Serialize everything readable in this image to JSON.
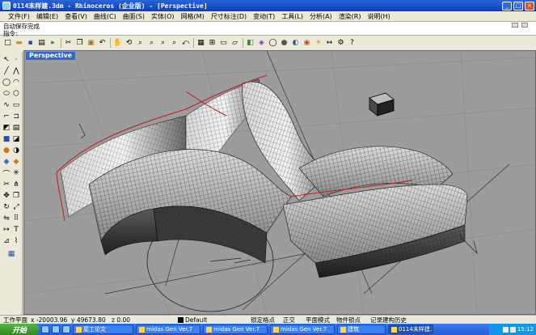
{
  "window": {
    "title": "0114末样建.3dm - Rhinoceros (企业版) - [Perspective]",
    "min_label": "_",
    "max_label": "□",
    "close_label": "×"
  },
  "menu": [
    "文件(F)",
    "编辑(E)",
    "查看(V)",
    "曲线(C)",
    "曲面(S)",
    "实体(O)",
    "网格(M)",
    "尺寸标注(D)",
    "变动(T)",
    "工具(L)",
    "分析(A)",
    "渲染(R)",
    "说明(H)"
  ],
  "command": {
    "history": "自动保存完成",
    "prompt": "指令:"
  },
  "viewport": {
    "label": "Perspective"
  },
  "status": {
    "plane": "工作平面",
    "x": "x -20003.96",
    "y": "y 49673.80",
    "z": "z 0.00",
    "layer": "Default",
    "snap": "锁定格点",
    "ortho": "正交",
    "planar": "平面模式",
    "osnap": "物件锁点",
    "history": "记录建构历史"
  },
  "taskbar": {
    "start": "开始",
    "tasks": [
      "屋工论文",
      "midas Gen Ver.7",
      "midas Gen Ver.7",
      "midas Gen Ver.7",
      "建筑",
      "0114末样建.3dm"
    ],
    "clock": "15:12"
  },
  "colors": {
    "viewport_bg": "#9c9c9c",
    "titlebar": "#0a3fb8",
    "surface_edge": "#c0181f"
  }
}
